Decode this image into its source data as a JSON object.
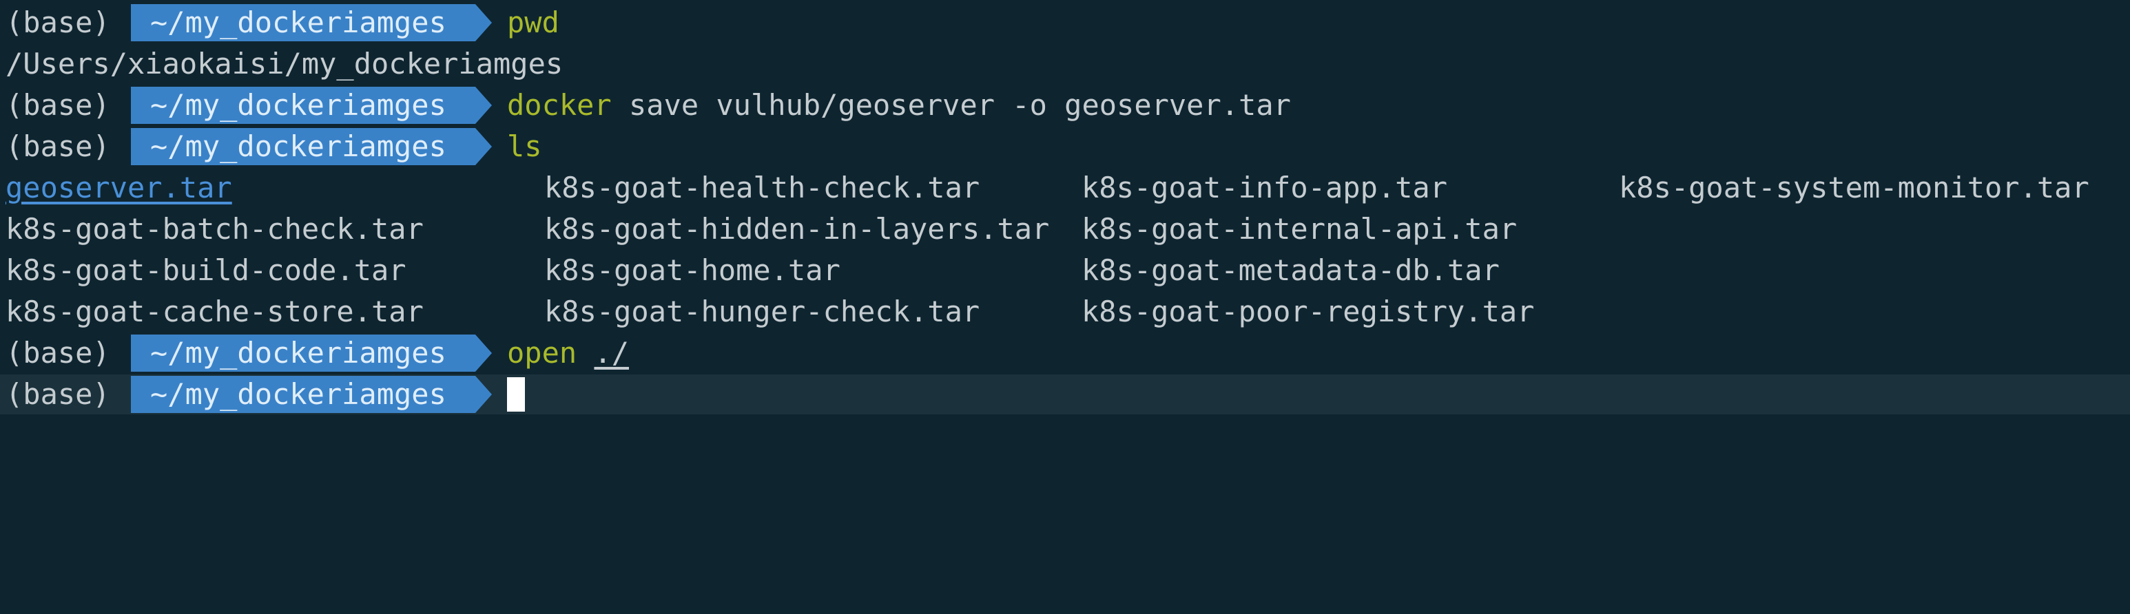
{
  "terminal": {
    "env": "(base)",
    "prompt_dir": "~/my_dockeriamges",
    "commands": {
      "pwd": {
        "cmd": "pwd"
      },
      "pwd_output": "/Users/xiaokaisi/my_dockeriamges",
      "save": {
        "cmd": "docker",
        "args": "save vulhub/geoserver -o geoserver.tar"
      },
      "ls": {
        "cmd": "ls"
      },
      "open": {
        "cmd": "open",
        "arg": "./"
      }
    },
    "ls_output": {
      "row1": [
        "geoserver.tar",
        "k8s-goat-health-check.tar",
        "k8s-goat-info-app.tar",
        "k8s-goat-system-monitor.tar"
      ],
      "row2": [
        "k8s-goat-batch-check.tar",
        "k8s-goat-hidden-in-layers.tar",
        "k8s-goat-internal-api.tar"
      ],
      "row3": [
        "k8s-goat-build-code.tar",
        "k8s-goat-home.tar",
        "k8s-goat-metadata-db.tar"
      ],
      "row4": [
        "k8s-goat-cache-store.tar",
        "k8s-goat-hunger-check.tar",
        "k8s-goat-poor-registry.tar"
      ]
    },
    "colors": {
      "background": "#0e2530",
      "prompt_bg": "#3a82c8",
      "command": "#a9ba2b",
      "link": "#4a90d9"
    }
  }
}
